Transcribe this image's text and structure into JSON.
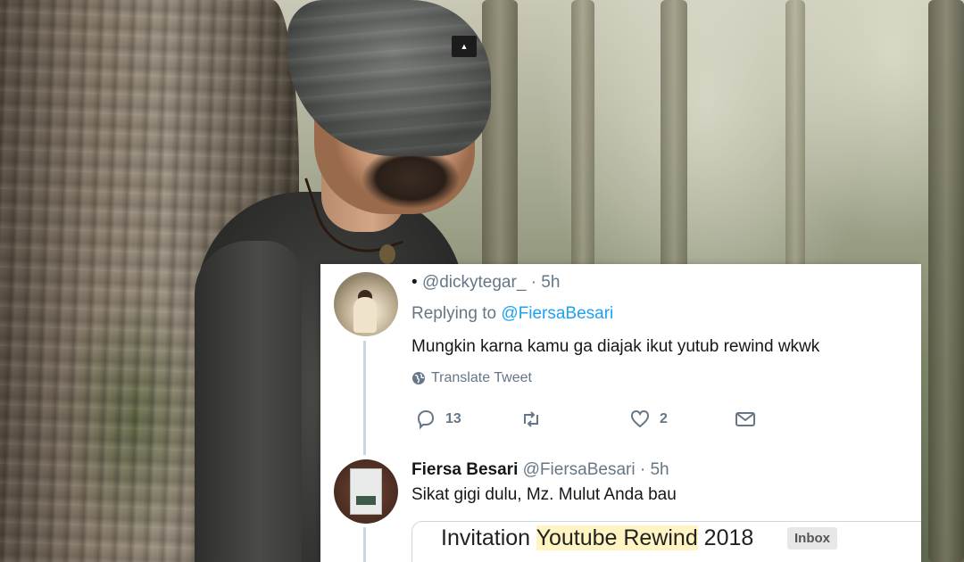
{
  "tweet1": {
    "username": "@dickytegar_",
    "time": "· 5h",
    "replying_prefix": "Replying to",
    "replying_to": "@FiersaBesari",
    "text": "Mungkin karna kamu ga diajak ikut yutub rewind wkwk",
    "translate_label": "Translate Tweet",
    "reply_count": "13",
    "retweet_count": "",
    "like_count": "2",
    "icons": [
      "reply-icon",
      "retweet-icon",
      "like-icon",
      "message-icon"
    ]
  },
  "tweet2": {
    "name": "Fiersa Besari",
    "handle": "@FiersaBesari",
    "time": "· 5h",
    "text": "Sikat gigi dulu, Mz. Mulut Anda bau"
  },
  "email": {
    "subject_1": "Invitation ",
    "subject_2": "Youtube Rewind",
    "subject_3": " 2018",
    "badge": "Inbox"
  },
  "photo": {
    "beanie_logo": "EIGER"
  },
  "colors": {
    "link": "#1da1f2",
    "muted": "#657786",
    "text": "#14171a"
  }
}
